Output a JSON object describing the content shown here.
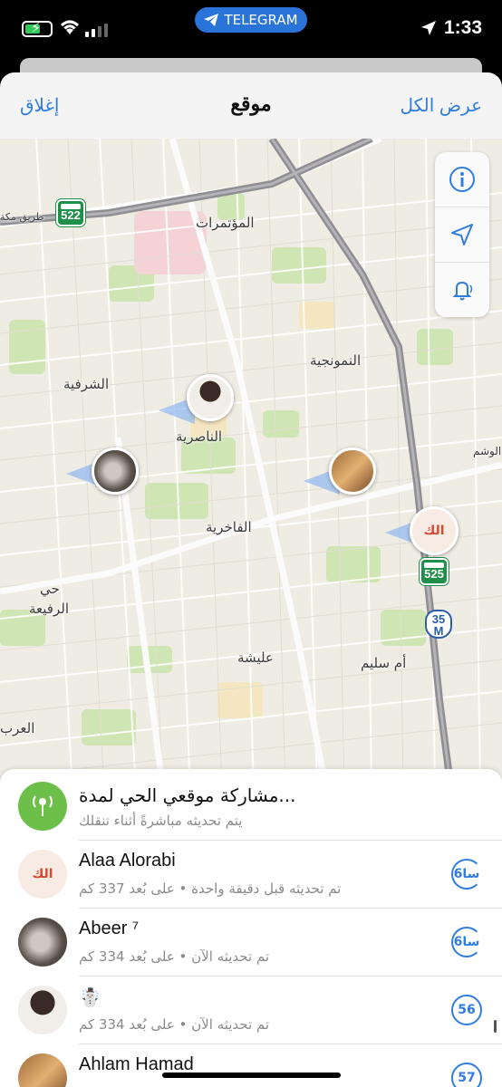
{
  "status_bar": {
    "app_pill": "TELEGRAM",
    "time": "1:33"
  },
  "navbar": {
    "close_label": "إغلاق",
    "title": "موقع",
    "show_all_label": "عرض الكل"
  },
  "map": {
    "labels": {
      "conferences": "المؤتمرات",
      "numoonjia": "النمونجية",
      "sharafia": "الشرفية",
      "nasiriya": "الناصرية",
      "wasm": "الوشم",
      "fakhriya": "الفاخرية",
      "rafeea_1": "حي",
      "rafeea_2": "الرفيعة",
      "olaysha": "عليشة",
      "umm_sulaym": "أم سليم",
      "mecca_road": "طريق مكة",
      "arabi": "العرب"
    },
    "road_shields": [
      "522",
      "525"
    ],
    "motorway_shield": {
      "number": "35",
      "letter": "M"
    },
    "brand_mark": "الك"
  },
  "list": {
    "share_row": {
      "title": "مشاركة موقعي الحي لمدة...",
      "subtitle": "يتم تحديثه مباشرةً أثناء تنقلك"
    },
    "contacts": [
      {
        "name": "Alaa Alorabi",
        "subtitle": "تم تحديثه قبل دقيقة واحدة • على بُعد 337 كم",
        "timer": "6سا"
      },
      {
        "name": "Abeer ⁷",
        "subtitle": "تم تحديثه الآن • على بُعد 334 كم",
        "timer": "6سا"
      },
      {
        "name": "☃️",
        "subtitle": "تم تحديثه الآن • على بُعد 334 كم",
        "timer": "56"
      },
      {
        "name": "Ahlam Hamad",
        "subtitle": "",
        "timer": "57"
      }
    ]
  }
}
